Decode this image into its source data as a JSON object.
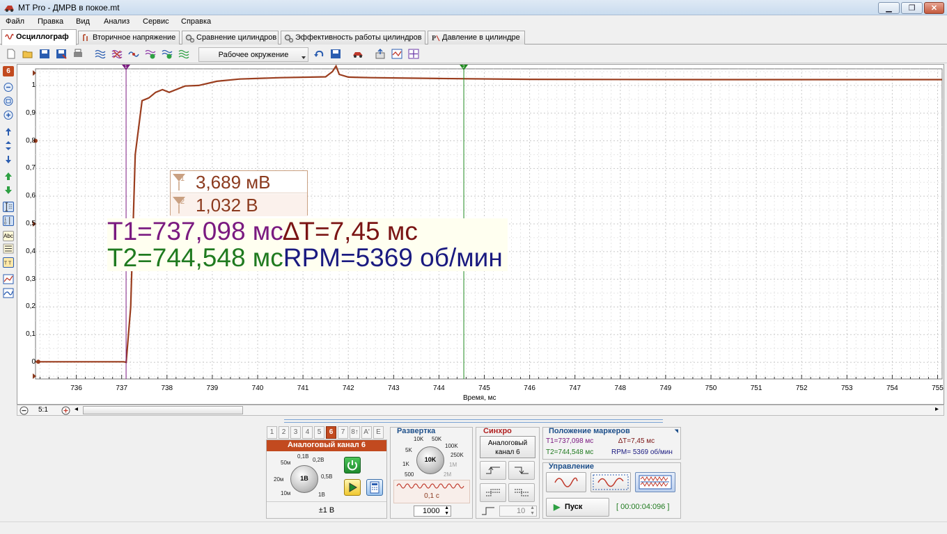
{
  "window": {
    "title": "MT Pro - ДМРВ в покое.mt",
    "minimize_icon": "minimize-icon",
    "maximize_icon": "restore-icon",
    "close_icon": "close-icon",
    "accent": "#c24a1f"
  },
  "menu": [
    "Файл",
    "Правка",
    "Вид",
    "Анализ",
    "Сервис",
    "Справка"
  ],
  "tabs": [
    {
      "label": "Осциллограф",
      "icon": "oscilloscope-icon",
      "active": true
    },
    {
      "label": "Вторичное напряжение",
      "icon": "ignition-icon",
      "active": false
    },
    {
      "label": "Сравнение цилиндров",
      "icon": "gears-icon",
      "active": false
    },
    {
      "label": "Эффективность работы цилиндров",
      "icon": "gears-icon",
      "active": false
    },
    {
      "label": "Давление в цилиндре",
      "icon": "pressure-icon",
      "active": false
    }
  ],
  "toolbar": {
    "environment_label": "Рабочее окружение"
  },
  "left_tools": {
    "channel_badge": "6",
    "abc_label": "Abc"
  },
  "measurements": {
    "marker1_value": "3,689 мВ",
    "marker2_value": "1,032 В",
    "marker1_index": "1",
    "marker2_index": "2"
  },
  "overlay": {
    "t1": "T1=737,098 мс",
    "dt": "∆T=7,45 мс",
    "t2": "T2=744,548 мс",
    "rpm": "RPM=5369 об/мин",
    "t1_color": "#7a1a80",
    "dt_color": "#7a1414",
    "t2_color": "#1f7a1f",
    "rpm_color": "#1a1a80"
  },
  "chart_data": {
    "type": "line",
    "xlabel": "Время, мс",
    "ylabel": "",
    "x_ticks": [
      "736",
      "737",
      "738",
      "739",
      "740",
      "741",
      "742",
      "743",
      "744",
      "745",
      "746",
      "747",
      "748",
      "749",
      "750",
      "751",
      "752",
      "753",
      "754",
      "755"
    ],
    "y_ticks": [
      "0",
      "0,1",
      "0,2",
      "0,3",
      "0,4",
      "0,5",
      "0,6",
      "0,7",
      "0,8",
      "0,9",
      "1"
    ],
    "xlim": [
      735.1,
      755.1
    ],
    "ylim": [
      -0.06,
      1.06
    ],
    "grid": true,
    "series": [
      {
        "color": "#9a3d1e",
        "x": [
          735.1,
          737.05,
          737.1,
          737.2,
          737.3,
          737.45,
          737.6,
          737.75,
          737.9,
          738.05,
          738.2,
          738.4,
          738.7,
          739.1,
          739.6,
          740.5,
          741.5,
          741.65,
          741.73,
          741.8,
          742.0,
          742.5,
          744.0,
          746.0,
          750.0,
          755.1
        ],
        "y": [
          0.002,
          0.002,
          0.0,
          0.2,
          0.75,
          0.945,
          0.955,
          0.975,
          0.985,
          0.975,
          0.985,
          0.998,
          1.0,
          1.015,
          1.023,
          1.028,
          1.031,
          1.05,
          1.07,
          1.04,
          1.03,
          1.028,
          1.025,
          1.022,
          1.021,
          1.021
        ]
      }
    ],
    "markers": [
      {
        "name": "T1",
        "x": 737.098,
        "color": "#7a1a80"
      },
      {
        "name": "T2",
        "x": 744.548,
        "color": "#1f8a1f"
      }
    ]
  },
  "zoom": {
    "level": "5:1"
  },
  "channel_panel": {
    "tabs": [
      "1",
      "2",
      "3",
      "4",
      "5",
      "6",
      "7",
      "8↑",
      "A'",
      "E"
    ],
    "active_tab": "6",
    "title": "Аналоговый канал 6",
    "knob_value": "1В",
    "knob_labels": [
      "0,1В",
      "0,2В",
      "50м",
      "0,5В",
      "20м",
      "10м",
      "1В"
    ],
    "range": "±1 В"
  },
  "sweep_panel": {
    "title": "Развертка",
    "knob_value": "10K",
    "knob_labels": [
      "10K",
      "50K",
      "5K",
      "100K",
      "250K",
      "1K",
      "1M",
      "500",
      "2M"
    ],
    "time": "0,1 с",
    "points": "1000"
  },
  "sync_panel": {
    "title": "Синхро",
    "source_line1": "Аналоговый",
    "source_line2": "канал 6",
    "level": "10"
  },
  "markers_panel": {
    "title": "Положение маркеров",
    "t1": "T1=737,098 мс",
    "dt": "∆T=7,45 мс",
    "t2": "T2=744,548 мс",
    "rpm": "RPM= 5369 об/мин"
  },
  "control_panel": {
    "title": "Управление",
    "start_label": "Пуск",
    "timer": "[ 00:00:04:096 ]"
  }
}
